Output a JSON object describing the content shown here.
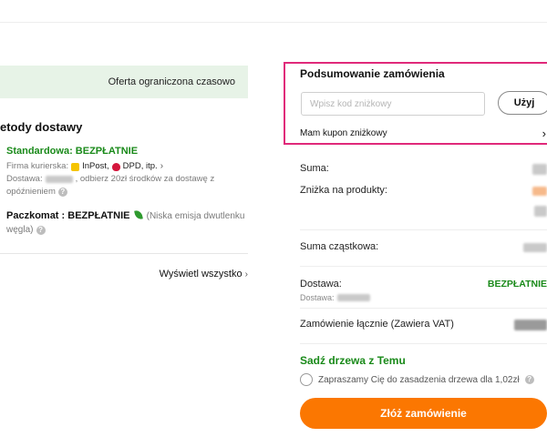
{
  "left": {
    "offer_banner": "Oferta ograniczona czasowo",
    "delivery_title": "etody dostawy",
    "standard": {
      "title": "Standardowa: BEZPŁATNIE",
      "carrier_label": "Firma kurierska:",
      "carrier_inpost": "InPost,",
      "carrier_dpd": "DPD, itp.",
      "delivery_label": "Dostawa:",
      "delivery_desc_1": ", odbierz 20zł środków za dostawę z",
      "delivery_desc_2": "opóźnieniem"
    },
    "paczkomat": {
      "title": "Paczkomat : BEZPŁATNIE",
      "note_1": "(Niska emisja dwutlenku",
      "note_2": "węgla)"
    },
    "view_all": "Wyświetl wszystko"
  },
  "summary": {
    "title": "Podsumowanie zamówienia",
    "coupon_placeholder": "Wpisz kod zniżkowy",
    "apply_label": "Użyj",
    "coupon_link": "Mam kupon zniżkowy",
    "rows": {
      "suma": "Suma:",
      "discount": "Zniżka na produkty:",
      "subtotal": "Suma cząstkowa:",
      "shipping": "Dostawa:",
      "shipping_value": "BEZPŁATNIE",
      "shipping_sub": "Dostawa:",
      "total": "Zamówienie łącznie (Zawiera VAT)"
    },
    "tree_title": "Sadź drzewa z Temu",
    "tree_option": "Zapraszamy Cię do zasadzenia drzewa dla 1,02zł",
    "order_button": "Złóż zamówienie"
  },
  "colors": {
    "accent_orange": "#fb7701",
    "green": "#1a8a1a",
    "highlight_pink": "#e0297a",
    "banner_bg": "#e7f3e7"
  }
}
